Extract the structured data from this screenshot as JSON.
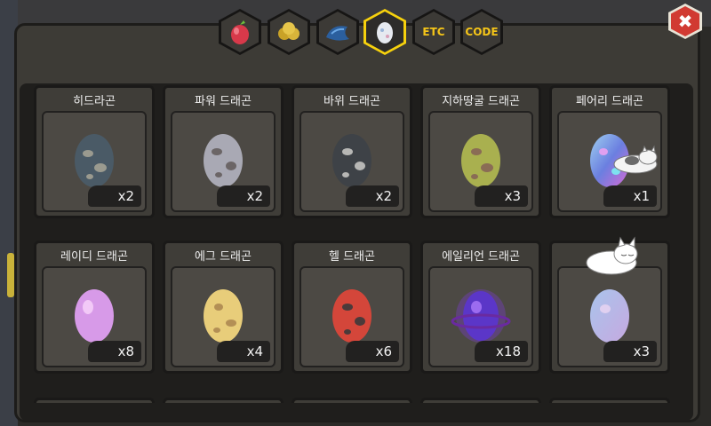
{
  "tabs": [
    {
      "icon": "red-fruit-icon",
      "label": "",
      "active": false
    },
    {
      "icon": "gold-coins-icon",
      "label": "",
      "active": false
    },
    {
      "icon": "blue-shell-icon",
      "label": "",
      "active": false
    },
    {
      "icon": "egg-icon",
      "label": "",
      "active": true
    },
    {
      "icon": "",
      "label": "ETC",
      "active": false
    },
    {
      "icon": "",
      "label": "CODE",
      "active": false
    }
  ],
  "close_label": "✖",
  "eggs": [
    {
      "name": "히드라곤",
      "count": "x2",
      "base": "#4a5a66",
      "spot": "#9a9a8f"
    },
    {
      "name": "파워 드래곤",
      "count": "x2",
      "base": "#a9a9b4",
      "spot": "#6b6566"
    },
    {
      "name": "바위 드래곤",
      "count": "x2",
      "base": "#3e4247",
      "spot": "#b7b7b5"
    },
    {
      "name": "지하땅굴 드래곤",
      "count": "x3",
      "base": "#a9b04f",
      "spot": "#8a6c55"
    },
    {
      "name": "페어리 드래곤",
      "count": "x1",
      "base": "#7db5e0",
      "spot": "#c66ad6"
    },
    {
      "name": "레이디 드래곤",
      "count": "x8",
      "base": "#d79ae8",
      "spot": "#f2c9f7"
    },
    {
      "name": "에그 드래곤",
      "count": "x4",
      "base": "#e8cd7a",
      "spot": "#b38f55"
    },
    {
      "name": "헬 드래곤",
      "count": "x6",
      "base": "#d4463a",
      "spot": "#4b3a3a"
    },
    {
      "name": "에일리언 드래곤",
      "count": "x18",
      "base": "#5b36c8",
      "spot": "#9c6bf0"
    },
    {
      "name": "",
      "count": "x3",
      "base": "#a9b4e4",
      "spot": "#d6bbe0"
    }
  ],
  "colors": {
    "accent": "#f6d10d",
    "panel": "#3d3b36",
    "close": "#d13a32"
  }
}
